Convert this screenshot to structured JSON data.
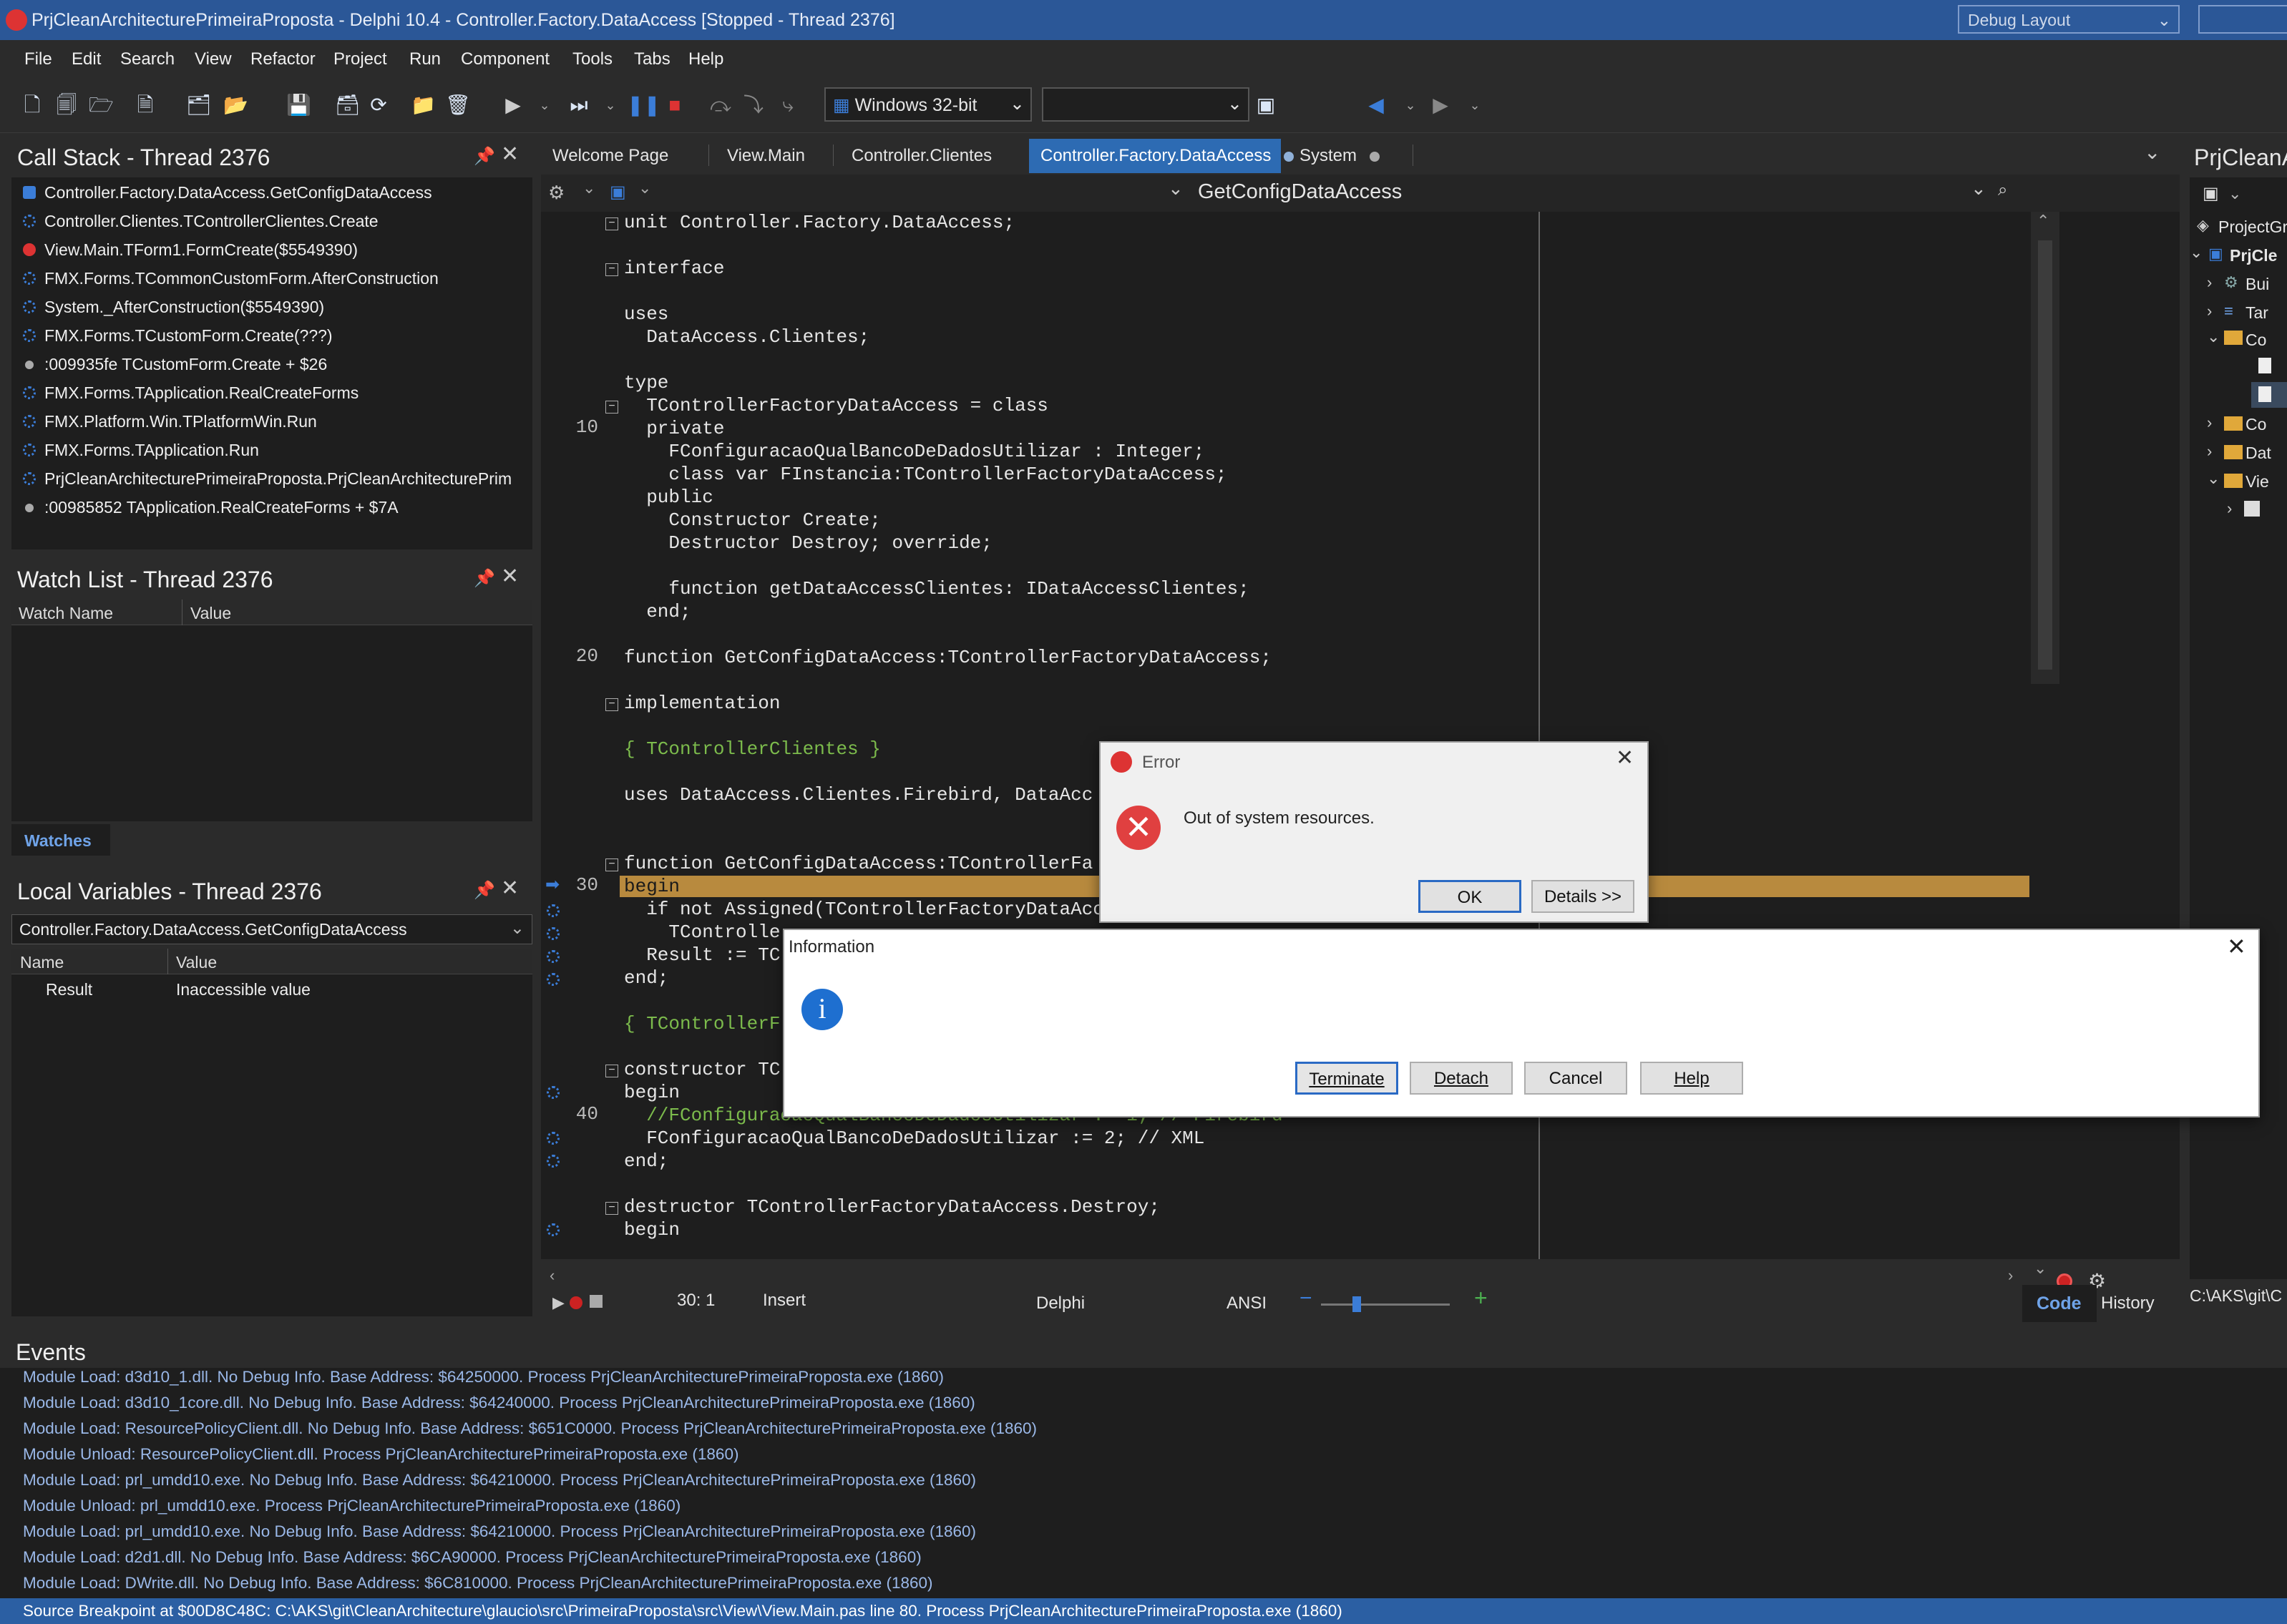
{
  "window": {
    "title": "PrjCleanArchitecturePrimeiraProposta - Delphi 10.4 - Controller.Factory.DataAccess [Stopped - Thread 2376]",
    "layout_combo": "Debug Layout"
  },
  "menu": [
    "File",
    "Edit",
    "Search",
    "View",
    "Refactor",
    "Project",
    "Run",
    "Component",
    "Tools",
    "Tabs",
    "Help"
  ],
  "toolbar": {
    "platform": "Windows 32-bit",
    "config": ""
  },
  "call_stack": {
    "title": "Call Stack - Thread 2376",
    "rows": [
      "Controller.Factory.DataAccess.GetConfigDataAccess",
      "Controller.Clientes.TControllerClientes.Create",
      "View.Main.TForm1.FormCreate($5549390)",
      "FMX.Forms.TCommonCustomForm.AfterConstruction",
      "System._AfterConstruction($5549390)",
      "FMX.Forms.TCustomForm.Create(???)",
      ":009935fe TCustomForm.Create + $26",
      "FMX.Forms.TApplication.RealCreateForms",
      "FMX.Platform.Win.TPlatformWin.Run",
      "FMX.Forms.TApplication.Run",
      "PrjCleanArchitecturePrimeiraProposta.PrjCleanArchitecturePrim",
      ":00985852 TApplication.RealCreateForms + $7A"
    ]
  },
  "watch_list": {
    "title": "Watch List - Thread 2376",
    "col_name": "Watch Name",
    "col_value": "Value",
    "tab": "Watches"
  },
  "local_vars": {
    "title": "Local Variables - Thread 2376",
    "scope": "Controller.Factory.DataAccess.GetConfigDataAccess",
    "col_name": "Name",
    "col_value": "Value",
    "row_name": "Result",
    "row_value": "Inaccessible value"
  },
  "editor": {
    "tabs": [
      "Welcome Page",
      "View.Main",
      "Controller.Clientes",
      "Controller.Factory.DataAccess",
      "System"
    ],
    "method_combo": "GetConfigDataAccess",
    "line_numbers": [
      "10",
      "20",
      "30",
      "40"
    ],
    "lines": [
      "unit Controller.Factory.DataAccess;",
      "",
      "interface",
      "",
      "uses",
      "  DataAccess.Clientes;",
      "",
      "type",
      "  TControllerFactoryDataAccess = class",
      "  private",
      "    FConfiguracaoQualBancoDeDadosUtilizar : Integer;",
      "    class var FInstancia:TControllerFactoryDataAccess;",
      "  public",
      "    Constructor Create;",
      "    Destructor Destroy; override;",
      "",
      "    function getDataAccessClientes: IDataAccessClientes;",
      "  end;",
      "",
      "function GetConfigDataAccess:TControllerFactoryDataAccess;",
      "",
      "implementation",
      "",
      "{ TControllerClientes }",
      "",
      "uses DataAccess.Clientes.Firebird, DataAcc",
      "",
      "",
      "function GetConfigDataAccess:TControllerFa",
      "begin",
      "  if not Assigned(TControllerFactoryDataAcc",
      "    TControlle",
      "  Result := TC",
      "end;",
      "",
      "{ TControllerF",
      "",
      "constructor TC",
      "begin",
      "  //FConfiguracaoQualBancoDeDadosUtilizar := 1; // Firebird",
      "  FConfiguracaoQualBancoDeDadosUtilizar := 2; // XML",
      "end;",
      "",
      "destructor TControllerFactoryDataAccess.Destroy;",
      "begin"
    ]
  },
  "status": {
    "position": "30:  1",
    "mode": "Insert",
    "language": "Delphi",
    "encoding": "ANSI",
    "tab_code": "Code",
    "tab_history": "History"
  },
  "right_panel": {
    "title": "PrjCleanA",
    "items": [
      "ProjectGr",
      "PrjCle",
      "Bui",
      "Tar",
      "Co",
      "Co",
      "Dat",
      "Vie"
    ],
    "path": "C:\\AKS\\git\\C"
  },
  "error_dialog": {
    "title": "Error",
    "message": "Out of system resources.",
    "ok": "OK",
    "details": "Details >>"
  },
  "info_dialog": {
    "title": "Information",
    "terminate": "Terminate",
    "detach": "Detach",
    "cancel": "Cancel",
    "help": "Help"
  },
  "events": {
    "title": "Events",
    "lines": [
      "Module Load: d3d10_1.dll. No Debug Info. Base Address: $64250000. Process PrjCleanArchitecturePrimeiraProposta.exe (1860)",
      "Module Load: d3d10_1core.dll. No Debug Info. Base Address: $64240000. Process PrjCleanArchitecturePrimeiraProposta.exe (1860)",
      "Module Load: ResourcePolicyClient.dll. No Debug Info. Base Address: $651C0000. Process PrjCleanArchitecturePrimeiraProposta.exe (1860)",
      "Module Unload: ResourcePolicyClient.dll. Process PrjCleanArchitecturePrimeiraProposta.exe (1860)",
      "Module Load: prl_umdd10.exe. No Debug Info. Base Address: $64210000. Process PrjCleanArchitecturePrimeiraProposta.exe (1860)",
      "Module Unload: prl_umdd10.exe. Process PrjCleanArchitecturePrimeiraProposta.exe (1860)",
      "Module Load: prl_umdd10.exe. No Debug Info. Base Address: $64210000. Process PrjCleanArchitecturePrimeiraProposta.exe (1860)",
      "Module Load: d2d1.dll. No Debug Info. Base Address: $6CA90000. Process PrjCleanArchitecturePrimeiraProposta.exe (1860)",
      "Module Load: DWrite.dll. No Debug Info. Base Address: $6C810000. Process PrjCleanArchitecturePrimeiraProposta.exe (1860)"
    ],
    "selected": "Source Breakpoint at $00D8C48C: C:\\AKS\\git\\CleanArchitecture\\glaucio\\src\\PrimeiraProposta\\src\\View\\View.Main.pas line 80. Process PrjCleanArchitecturePrimeiraProposta.exe (1860)"
  },
  "colors": {
    "accent": "#2d6bb3",
    "exec_line": "#b88a3e",
    "titlebar": "#2b5797"
  }
}
